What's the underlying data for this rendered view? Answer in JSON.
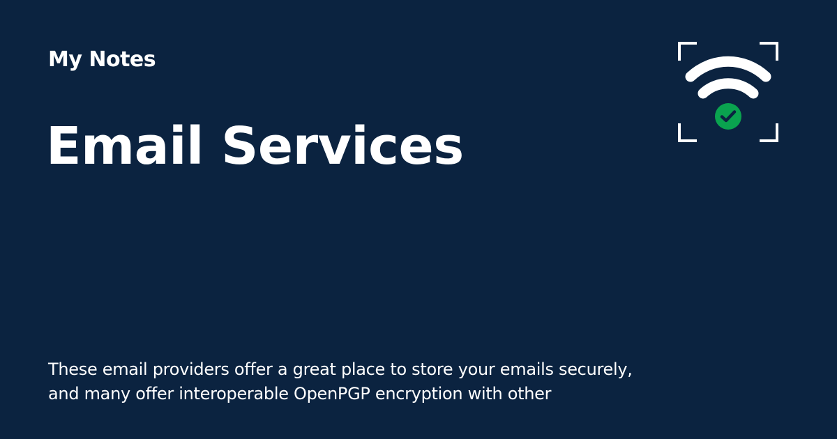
{
  "header": {
    "site_name": "My Notes"
  },
  "main": {
    "title": "Email Services",
    "description_lines": [
      "These email providers offer a great place to store your emails securely,",
      "and many offer interoperable OpenPGP encryption with other"
    ]
  },
  "logo": {
    "icon": "wifi-check-icon",
    "frame_icon": "scan-frame-icon",
    "check_icon": "check-circle-icon"
  },
  "colors": {
    "background": "#0b2340",
    "text": "#ffffff",
    "accent": "#0aa34f"
  }
}
